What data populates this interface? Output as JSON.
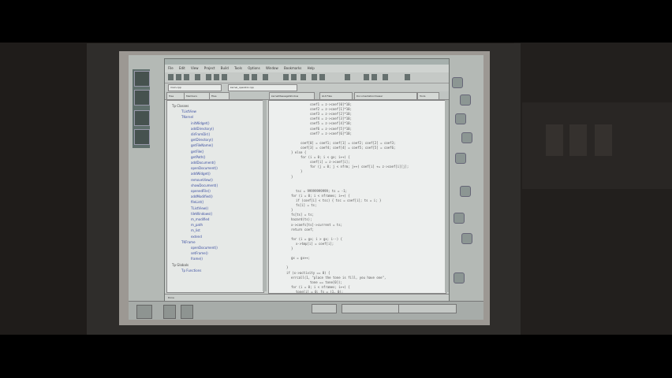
{
  "app": {
    "menu": [
      "File",
      "Edit",
      "View",
      "Project",
      "Build",
      "Tools",
      "Options",
      "Window",
      "Bookmarks",
      "Help"
    ],
    "combo_left": "main.cpp",
    "combo_right": "kernel_operator.cpp",
    "tabs": [
      "Tree",
      "Members",
      "Files",
      "kernelMessageWindow",
      "GUI Files",
      "DocumentationViewer",
      "Tools"
    ],
    "status": "Done"
  },
  "tree": [
    {
      "label": "Tp Classes",
      "indent": 0,
      "root": true
    },
    {
      "label": "TListView",
      "indent": 2,
      "root": false
    },
    {
      "label": "TKernel",
      "indent": 2,
      "root": false
    },
    {
      "label": "initWidget()",
      "indent": 4,
      "root": false
    },
    {
      "label": "addDirectory()",
      "indent": 4,
      "root": false
    },
    {
      "label": "dirFromDir()",
      "indent": 4,
      "root": false
    },
    {
      "label": "getDirectory()",
      "indent": 4,
      "root": false
    },
    {
      "label": "getFileName()",
      "indent": 4,
      "root": false
    },
    {
      "label": "getFile()",
      "indent": 4,
      "root": false
    },
    {
      "label": "getPath()",
      "indent": 4,
      "root": false
    },
    {
      "label": "addDocument()",
      "indent": 4,
      "root": false
    },
    {
      "label": "openDocument()",
      "indent": 4,
      "root": false
    },
    {
      "label": "addWidget()",
      "indent": 4,
      "root": false
    },
    {
      "label": "removeView()",
      "indent": 4,
      "root": false
    },
    {
      "label": "showDocument()",
      "indent": 4,
      "root": false
    },
    {
      "label": "openedFile()",
      "indent": 4,
      "root": false
    },
    {
      "label": "addModified()",
      "indent": 4,
      "root": false
    },
    {
      "label": "fileList()",
      "indent": 4,
      "root": false
    },
    {
      "label": "TListView()",
      "indent": 4,
      "root": false
    },
    {
      "label": "tileWindows()",
      "indent": 4,
      "root": false
    },
    {
      "label": "m_modified",
      "indent": 4,
      "root": false
    },
    {
      "label": "m_path",
      "indent": 4,
      "root": false
    },
    {
      "label": "m_list",
      "indent": 4,
      "root": false
    },
    {
      "label": "extend",
      "indent": 4,
      "root": false
    },
    {
      "label": "TKFrame",
      "indent": 2,
      "root": false
    },
    {
      "label": "openDocument()",
      "indent": 4,
      "root": false
    },
    {
      "label": "setFrame()",
      "indent": 4,
      "root": false
    },
    {
      "label": "frame()",
      "indent": 4,
      "root": false
    },
    {
      "label": "Tp Globals",
      "indent": 0,
      "root": true
    },
    {
      "label": "Tp Functions",
      "indent": 2,
      "root": false
    }
  ],
  "code": [
    {
      "text": "coef1 = z->coef[0]*10;",
      "indent": 48
    },
    {
      "text": "coef2 = z->coef[1]*10;",
      "indent": 48
    },
    {
      "text": "coef3 = z->coef[2]*10;",
      "indent": 48
    },
    {
      "text": "coef4 = z->coef[3]*10;",
      "indent": 48
    },
    {
      "text": "coef5 = z->coef[4]*10;",
      "indent": 48
    },
    {
      "text": "coef6 = z->coef[5]*10;",
      "indent": 48
    },
    {
      "text": "coef7 = z->coef[6]*10;",
      "indent": 48
    },
    {
      "text": "",
      "indent": 0
    },
    {
      "text": "coef[0] = coef1; coef[1] = coef2; coef[2] = coef3;",
      "indent": 36
    },
    {
      "text": "coef[3] = coef4; coef[4] = coef5; coef[5] = coef6;",
      "indent": 36
    },
    {
      "text": "} else {",
      "indent": 24
    },
    {
      "text": "for (i = 0; i < gx; i++) {",
      "indent": 36
    },
    {
      "text": "coef[i] = z->coef[i];",
      "indent": 48
    },
    {
      "text": "for (j = 0; j < nfrm; j++) coef[i] += z->coef[i][j];",
      "indent": 48
    },
    {
      "text": "}",
      "indent": 36
    },
    {
      "text": "}",
      "indent": 24
    },
    {
      "text": "",
      "indent": 0
    },
    {
      "text": "",
      "indent": 0
    },
    {
      "text": "tsc = 99999999999; ts = -1;",
      "indent": 30
    },
    {
      "text": "for (i = 0; i < nframes; i++) {",
      "indent": 24
    },
    {
      "text": "if (coef[i] < tsc) { tsc = coef[i]; ts = i; }",
      "indent": 30
    },
    {
      "text": "fs[i] = ts;",
      "indent": 30
    },
    {
      "text": "}",
      "indent": 24
    },
    {
      "text": "fs[ts] = ts;",
      "indent": 24
    },
    {
      "text": "hazard(ts);",
      "indent": 24
    },
    {
      "text": "x->coefs[ts]->current = ts;",
      "indent": 24
    },
    {
      "text": "return coef;",
      "indent": 24
    },
    {
      "text": "",
      "indent": 0
    },
    {
      "text": "for (i = gx; i > gx; i--) {",
      "indent": 24
    },
    {
      "text": "x->tmp[i] = coef[i];",
      "indent": 30
    },
    {
      "text": "}",
      "indent": 24
    },
    {
      "text": "",
      "indent": 0
    },
    {
      "text": "gx = gx++;",
      "indent": 24
    },
    {
      "text": "",
      "indent": 0
    },
    {
      "text": "}",
      "indent": 18
    },
    {
      "text": "if (x->activity == 0) {",
      "indent": 18
    },
    {
      "text": "errcall(1, \"place the tone is fill, you have one\",",
      "indent": 24
    },
    {
      "text": "tone == tone[0]);",
      "indent": 48
    },
    {
      "text": "for (i = 0; i < nframes; i++) {",
      "indent": 24
    },
    {
      "text": "tone[i] = 0; fs = (1, 0);",
      "indent": 30
    }
  ],
  "taskbar": {
    "field1": "",
    "field2": "",
    "field3": ""
  }
}
